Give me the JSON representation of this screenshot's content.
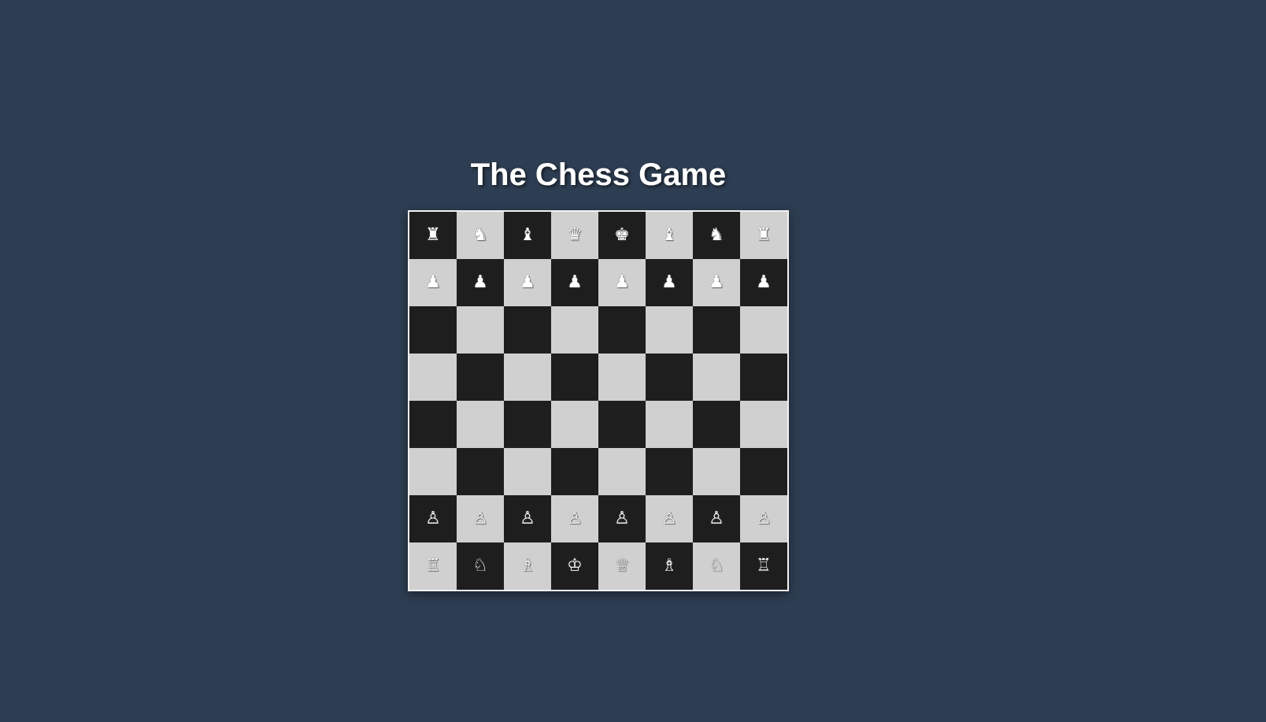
{
  "title": "The Chess Game",
  "colors": {
    "background": "#2e3e52",
    "light_square": "#d0d0d0",
    "dark_square": "#1e1e1e",
    "board_border": "#f2f2f2",
    "piece": "#ffffff"
  },
  "board": {
    "top_left_color": "dark",
    "rows": [
      [
        "♜",
        "♞",
        "♝",
        "♛",
        "♚",
        "♝",
        "♞",
        "♜"
      ],
      [
        "♟",
        "♟",
        "♟",
        "♟",
        "♟",
        "♟",
        "♟",
        "♟"
      ],
      [
        "",
        "",
        "",
        "",
        "",
        "",
        "",
        ""
      ],
      [
        "",
        "",
        "",
        "",
        "",
        "",
        "",
        ""
      ],
      [
        "",
        "",
        "",
        "",
        "",
        "",
        "",
        ""
      ],
      [
        "",
        "",
        "",
        "",
        "",
        "",
        "",
        ""
      ],
      [
        "♙",
        "♙",
        "♙",
        "♙",
        "♙",
        "♙",
        "♙",
        "♙"
      ],
      [
        "♖",
        "♘",
        "♗",
        "♔",
        "♕",
        "♗",
        "♘",
        "♖"
      ]
    ],
    "piece_names": [
      [
        "black-rook",
        "black-knight",
        "black-bishop",
        "black-queen",
        "black-king",
        "black-bishop",
        "black-knight",
        "black-rook"
      ],
      [
        "black-pawn",
        "black-pawn",
        "black-pawn",
        "black-pawn",
        "black-pawn",
        "black-pawn",
        "black-pawn",
        "black-pawn"
      ],
      [
        "",
        "",
        "",
        "",
        "",
        "",
        "",
        ""
      ],
      [
        "",
        "",
        "",
        "",
        "",
        "",
        "",
        ""
      ],
      [
        "",
        "",
        "",
        "",
        "",
        "",
        "",
        ""
      ],
      [
        "",
        "",
        "",
        "",
        "",
        "",
        "",
        ""
      ],
      [
        "white-pawn",
        "white-pawn",
        "white-pawn",
        "white-pawn",
        "white-pawn",
        "white-pawn",
        "white-pawn",
        "white-pawn"
      ],
      [
        "white-rook",
        "white-knight",
        "white-bishop",
        "white-king",
        "white-queen",
        "white-bishop",
        "white-knight",
        "white-rook"
      ]
    ]
  }
}
